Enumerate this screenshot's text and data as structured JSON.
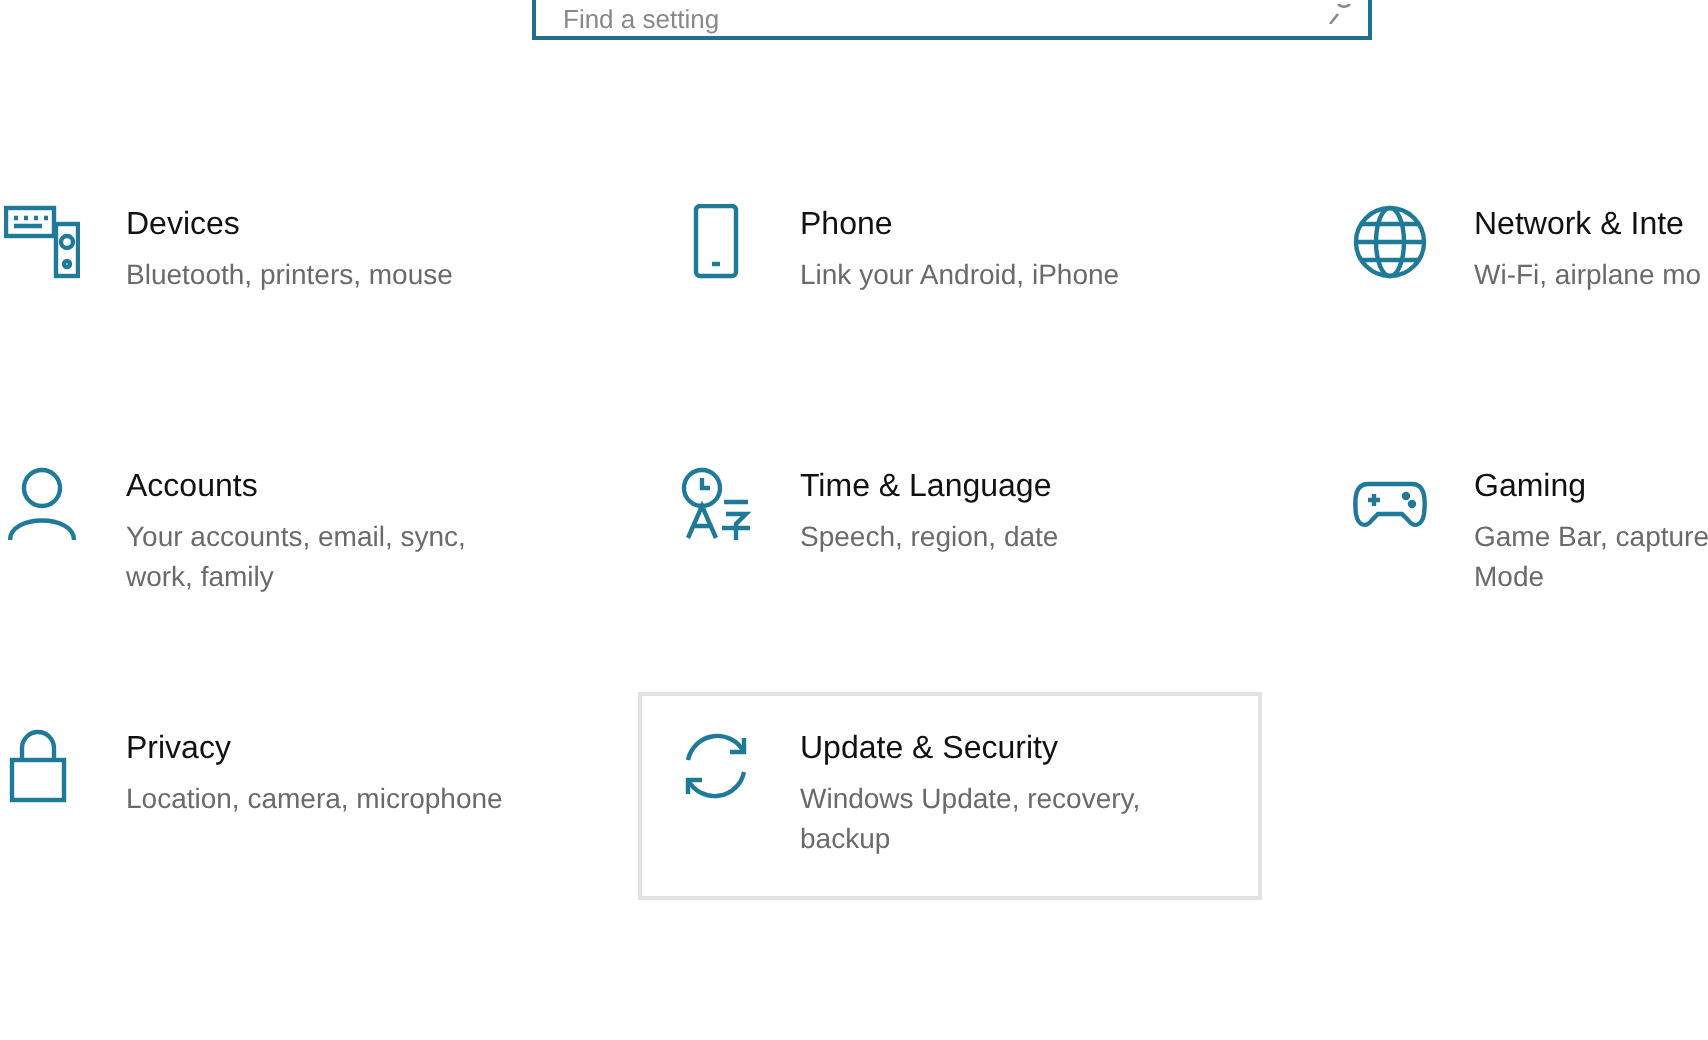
{
  "search": {
    "placeholder": "Find a setting"
  },
  "tiles": [
    {
      "kind": "devices",
      "title": "Devices",
      "subtitle": "Bluetooth, printers, mouse",
      "selected": false
    },
    {
      "kind": "phone",
      "title": "Phone",
      "subtitle": "Link your Android, iPhone",
      "selected": false
    },
    {
      "kind": "globe",
      "title": "Network & Inte",
      "subtitle": "Wi-Fi, airplane mo",
      "selected": false
    },
    {
      "kind": "person",
      "title": "Accounts",
      "subtitle": "Your accounts, email, sync,\nwork, family",
      "selected": false
    },
    {
      "kind": "language",
      "title": "Time & Language",
      "subtitle": "Speech, region, date",
      "selected": false
    },
    {
      "kind": "gamepad",
      "title": "Gaming",
      "subtitle": "Game Bar, capture\nMode",
      "selected": false
    },
    {
      "kind": "lock",
      "title": "Privacy",
      "subtitle": "Location, camera, microphone",
      "selected": false
    },
    {
      "kind": "sync",
      "title": "Update & Security",
      "subtitle": "Windows Update, recovery,\nbackup",
      "selected": true
    }
  ]
}
